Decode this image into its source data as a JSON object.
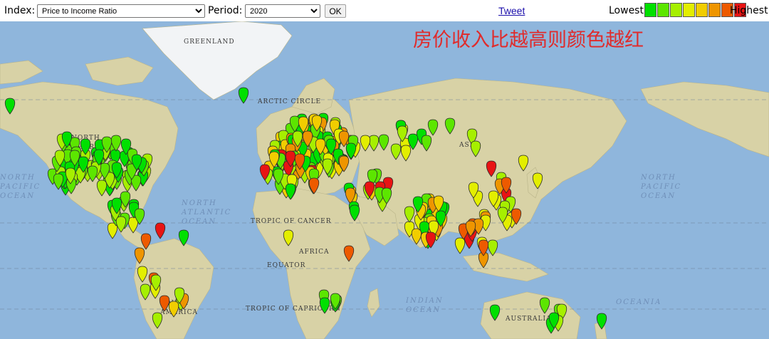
{
  "controls": {
    "index_label": "Index:",
    "index_selected": "Price to Income Ratio",
    "period_label": "Period:",
    "period_selected": "2020",
    "ok_label": "OK",
    "tweet_label": "Tweet"
  },
  "legend": {
    "lowest_label": "Lowest",
    "highest_label": "Highest",
    "scale_colors": [
      "#00e000",
      "#5ce600",
      "#a6ef00",
      "#e3ee00",
      "#f1cd00",
      "#ee9500",
      "#ed5a00",
      "#e81414"
    ]
  },
  "annotation": "房价收入比越高则颜色越红",
  "map_labels": {
    "greenland": "GREENLAND",
    "arctic_circle": "ARCTIC CIRCLE",
    "north_america": "NORTH AMERICA",
    "north_atlantic": "NORTH ATLANTIC OCEAN",
    "north_pacific_left": "NORTH PACIFIC OCEAN",
    "north_pacific_right": "NORTH PACIFIC OCEAN",
    "tropic_cancer": "TROPIC OF CANCER",
    "africa": "AFRICA",
    "equator": "EQUATOR",
    "tropic_capricorn": "TROPIC OF CAPRICORN",
    "indian_ocean": "INDIAN OCEAN",
    "australia": "AUSTRALIA",
    "oceania": "OCEANIA",
    "south_america": "SOUTH AMERICA",
    "asia": "ASIA"
  },
  "colors": {
    "ocean": "#8fb6dc",
    "land": "#d8d2a6",
    "forest": "#8ea86a",
    "ice": "#f2f4f6"
  },
  "marker_levels": [
    "#00e000",
    "#5ce600",
    "#a6ef00",
    "#e3ee00",
    "#f1cd00",
    "#ee9500",
    "#ed5a00",
    "#e81414"
  ]
}
